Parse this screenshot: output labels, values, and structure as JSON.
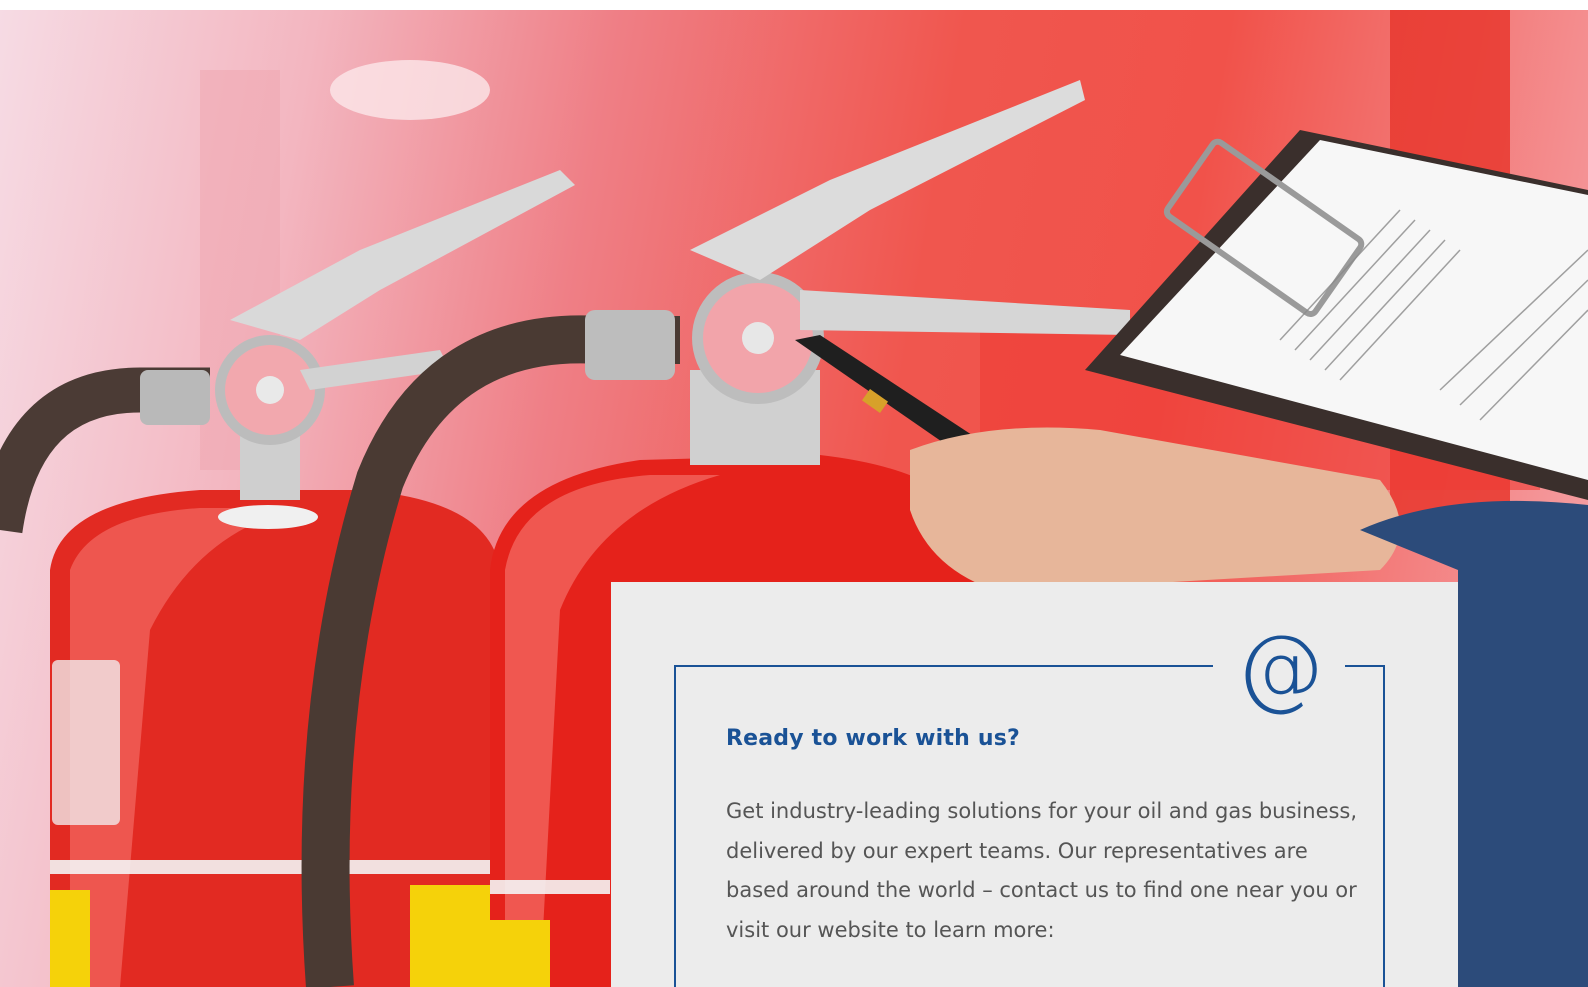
{
  "hero": {
    "image_subject": "fire-extinguisher-inspection-photo"
  },
  "contact_card": {
    "icon": "at-sign-icon",
    "icon_glyph": "@",
    "title": "Ready to work with us?",
    "body": "Get industry-leading solutions for your oil and gas business, delivered by our expert teams. Our representatives are based around the world – contact us to find one near you or visit our website to learn more:"
  },
  "colors": {
    "accent": "#1a5296",
    "card_background": "#ececec",
    "body_text": "#555555",
    "extinguisher_red": "#e8231d"
  }
}
